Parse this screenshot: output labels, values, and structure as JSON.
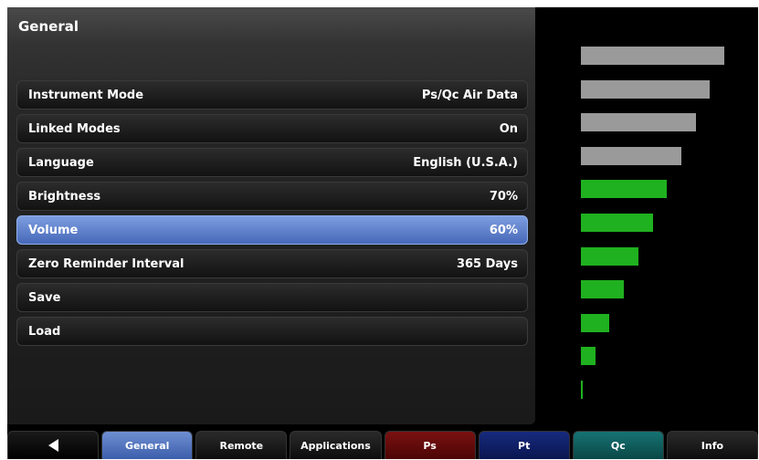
{
  "panel": {
    "title": "General"
  },
  "rows": [
    {
      "label": "Instrument Mode",
      "value": "Ps/Qc Air Data"
    },
    {
      "label": "Linked Modes",
      "value": "On"
    },
    {
      "label": "Language",
      "value": "English (U.S.A.)"
    },
    {
      "label": "Brightness",
      "value": "70%"
    },
    {
      "label": "Volume",
      "value": "60%"
    },
    {
      "label": "Zero Reminder Interval",
      "value": "365 Days"
    },
    {
      "label": "Save",
      "value": ""
    },
    {
      "label": "Load",
      "value": ""
    }
  ],
  "selected_row": "Volume",
  "volume_level": {
    "level_fraction": 0.6,
    "segments": [
      {
        "color": "#9a9a9a",
        "relative_length": 1.0
      },
      {
        "color": "#9a9a9a",
        "relative_length": 0.9
      },
      {
        "color": "#9a9a9a",
        "relative_length": 0.8
      },
      {
        "color": "#9a9a9a",
        "relative_length": 0.7
      },
      {
        "color": "#1fb11f",
        "relative_length": 0.6
      },
      {
        "color": "#1fb11f",
        "relative_length": 0.5
      },
      {
        "color": "#1fb11f",
        "relative_length": 0.4
      },
      {
        "color": "#1fb11f",
        "relative_length": 0.3
      },
      {
        "color": "#1fb11f",
        "relative_length": 0.2
      },
      {
        "color": "#1fb11f",
        "relative_length": 0.1
      },
      {
        "color": "#1fb11f",
        "relative_length": 0.015
      }
    ]
  },
  "tabs": [
    {
      "id": "back",
      "label": "",
      "icon": "back-triangle-icon"
    },
    {
      "id": "general",
      "label": "General"
    },
    {
      "id": "remote",
      "label": "Remote"
    },
    {
      "id": "applications",
      "label": "Applications"
    },
    {
      "id": "ps",
      "label": "Ps"
    },
    {
      "id": "pt",
      "label": "Pt"
    },
    {
      "id": "qc",
      "label": "Qc"
    },
    {
      "id": "info",
      "label": "Info"
    }
  ],
  "colors": {
    "selected_row": "#5a7ccc",
    "ps_tab": "#6b0d0d",
    "pt_tab": "#13236f",
    "qc_tab": "#136161",
    "level_green": "#1fb11f",
    "level_gray": "#9a9a9a"
  }
}
